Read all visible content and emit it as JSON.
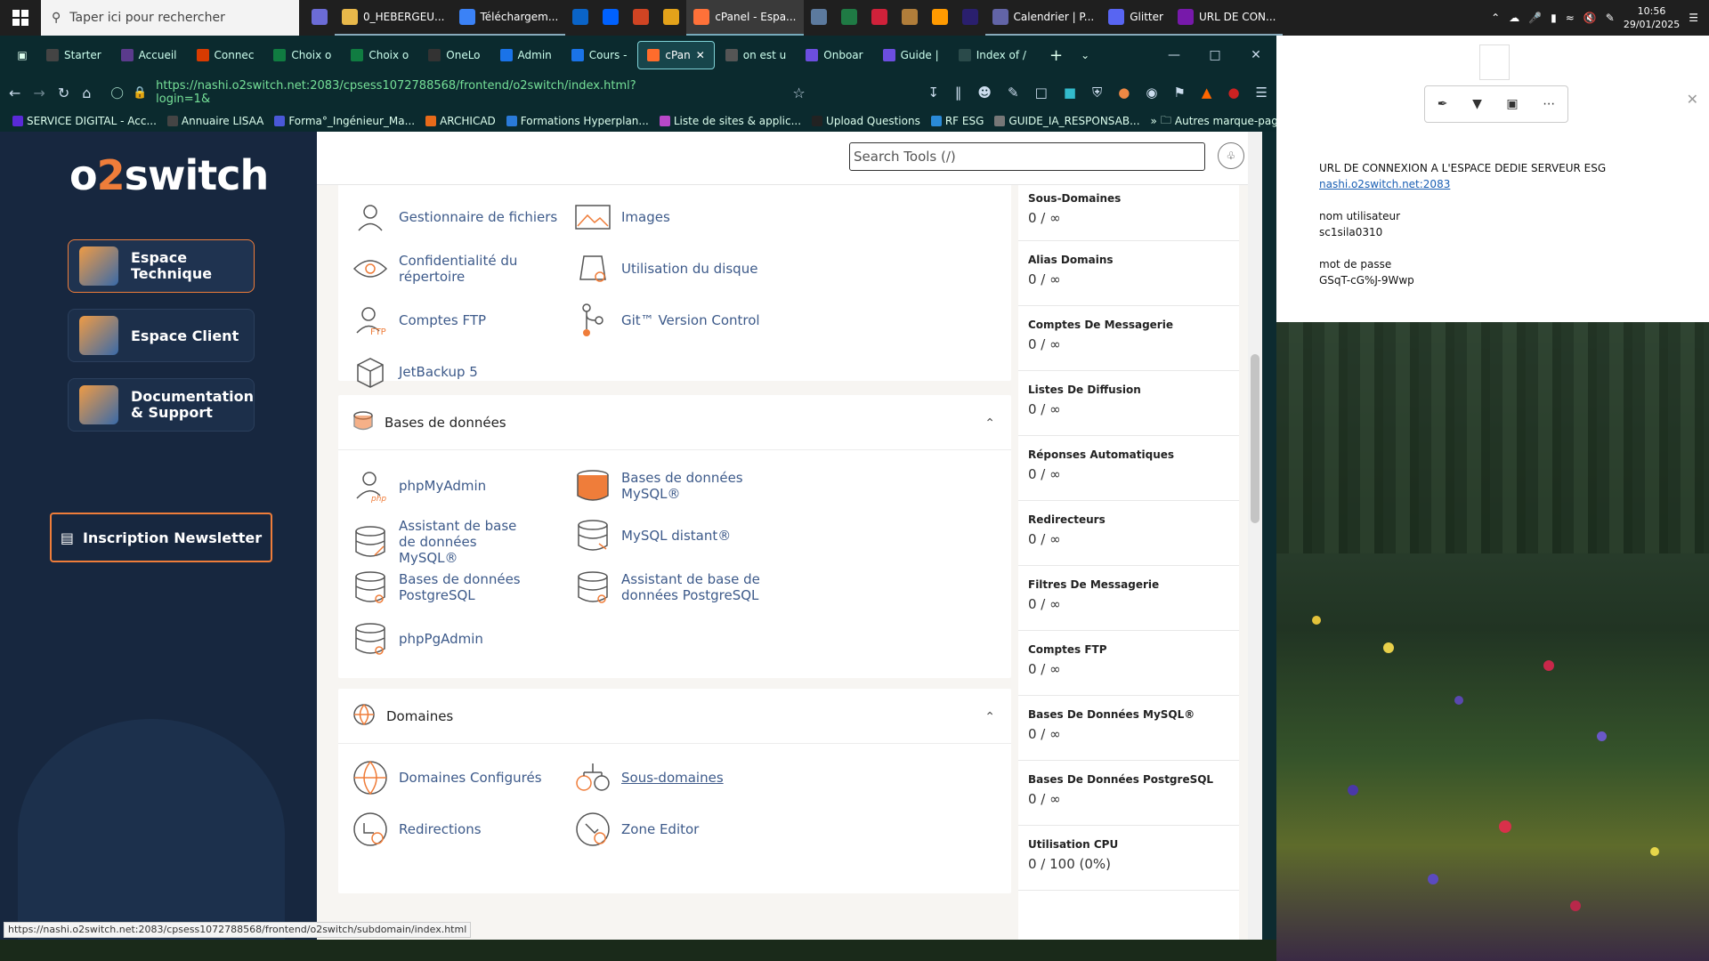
{
  "taskbar": {
    "search_placeholder": "Taper ici pour rechercher",
    "apps": [
      {
        "label": "",
        "icon": "user-icon",
        "color": "#6b6bd6"
      },
      {
        "label": "0_HEBERGEU...",
        "icon": "folder-icon",
        "color": "#e8b84a"
      },
      {
        "label": "Téléchargem...",
        "icon": "download-icon",
        "color": "#3b82f6"
      },
      {
        "label": "",
        "icon": "outlook-icon",
        "color": "#0a64c8"
      },
      {
        "label": "",
        "icon": "dropbox-icon",
        "color": "#0061fe"
      },
      {
        "label": "",
        "icon": "powerpoint-icon",
        "color": "#d04423"
      },
      {
        "label": "",
        "icon": "chrome-icon",
        "color": "#e3a21a"
      },
      {
        "label": "cPanel - Espa...",
        "icon": "firefox-icon",
        "color": "#ff7139"
      },
      {
        "label": "",
        "icon": "calculator-icon",
        "color": "#5c7a9e"
      },
      {
        "label": "",
        "icon": "excel-icon",
        "color": "#1f7a44"
      },
      {
        "label": "",
        "icon": "h-app-icon",
        "color": "#d0213a"
      },
      {
        "label": "",
        "icon": "tool-icon",
        "color": "#b07d3a"
      },
      {
        "label": "",
        "icon": "illustrator-icon",
        "color": "#ff9a00"
      },
      {
        "label": "",
        "icon": "premiere-icon",
        "color": "#2a1f6e"
      },
      {
        "label": "Calendrier | P...",
        "icon": "teams-icon",
        "color": "#6264a7"
      },
      {
        "label": "Glitter",
        "icon": "discord-icon",
        "color": "#5865f2"
      },
      {
        "label": "URL DE CON...",
        "icon": "onenote-icon",
        "color": "#7719aa"
      }
    ],
    "time": "10:56",
    "date": "29/01/2025"
  },
  "browser": {
    "tabs": [
      {
        "label": "Starter",
        "color": "#444"
      },
      {
        "label": "Accueil",
        "color": "#5b3b8c"
      },
      {
        "label": "Connec",
        "color": "#d83b01"
      },
      {
        "label": "Choix o",
        "color": "#107c41"
      },
      {
        "label": "Choix o",
        "color": "#107c41"
      },
      {
        "label": "OneLo",
        "color": "#333"
      },
      {
        "label": "Admin",
        "color": "#1a73e8"
      },
      {
        "label": "Cours -",
        "color": "#1a73e8"
      },
      {
        "label": "cPan",
        "color": "#ff6c2c"
      },
      {
        "label": "on est u",
        "color": "#555"
      },
      {
        "label": "Onboar",
        "color": "#6c4ee0"
      },
      {
        "label": "Guide |",
        "color": "#6c4ee0"
      },
      {
        "label": "Index of /",
        "color": "#2a4a4a"
      }
    ],
    "url": "https://nashi.o2switch.net:2083/cpsess1072788568/frontend/o2switch/index.html?login=1&",
    "bookmarks": [
      "SERVICE DIGITAL - Acc...",
      "Annuaire LISAA",
      "Forma°_Ingénieur_Ma...",
      "ARCHICAD",
      "Formations Hyperplan...",
      "Liste de sites & applic...",
      "Upload Questions",
      "RF ESG",
      "GUIDE_IA_RESPONSAB..."
    ],
    "other_bookmarks": "Autres marque-pages",
    "status_url": "https://nashi.o2switch.net:2083/cpsess1072788568/frontend/o2switch/subdomain/index.html"
  },
  "sidebar": {
    "logo_a": "o",
    "logo_b": "2",
    "logo_c": "switch",
    "buttons": [
      "Espace Technique",
      "Espace Client",
      "Documentation & Support"
    ],
    "newsletter": "Inscription Newsletter"
  },
  "topbar": {
    "search_placeholder": "Search Tools (/)"
  },
  "files": {
    "items": [
      "Gestionnaire de fichiers",
      "Images",
      "Confidentialité du répertoire",
      "Utilisation du disque",
      "Comptes FTP",
      "Git™ Version Control",
      "JetBackup 5"
    ]
  },
  "databases": {
    "title": "Bases de données",
    "items": [
      "phpMyAdmin",
      "Bases de données MySQL®",
      "Assistant de base de données MySQL®",
      "MySQL distant®",
      "Bases de données PostgreSQL",
      "Assistant de base de données PostgreSQL",
      "phpPgAdmin"
    ]
  },
  "domains": {
    "title": "Domaines",
    "items": [
      "Domaines Configurés",
      "Sous-domaines",
      "Redirections",
      "Zone Editor"
    ]
  },
  "stats": [
    {
      "label": "Sous-Domaines",
      "value": "0 / ∞"
    },
    {
      "label": "Alias Domains",
      "value": "0 / ∞"
    },
    {
      "label": "Comptes De Messagerie",
      "value": "0 / ∞"
    },
    {
      "label": "Listes De Diffusion",
      "value": "0 / ∞"
    },
    {
      "label": "Réponses Automatiques",
      "value": "0 / ∞"
    },
    {
      "label": "Redirecteurs",
      "value": "0 / ∞"
    },
    {
      "label": "Filtres De Messagerie",
      "value": "0 / ∞"
    },
    {
      "label": "Comptes FTP",
      "value": "0 / ∞"
    },
    {
      "label": "Bases De Données MySQL®",
      "value": "0 / ∞"
    },
    {
      "label": "Bases De Données PostgreSQL",
      "value": "0 / ∞"
    },
    {
      "label": "Utilisation CPU",
      "value": "0 / 100   (0%)"
    }
  ],
  "note": {
    "title": "URL DE CONNEXION A L'ESPACE DEDIE SERVEUR ESG",
    "link": "nashi.o2switch.net:2083",
    "user_label": "nom utilisateur",
    "user": "sc1sila0310",
    "pass_label": "mot de passe",
    "pass": "GSqT-cG%J-9Wwp"
  },
  "colors": {
    "accent": "#ef7d3a",
    "sidebar": "#17273f",
    "link": "#3d5a8a"
  }
}
